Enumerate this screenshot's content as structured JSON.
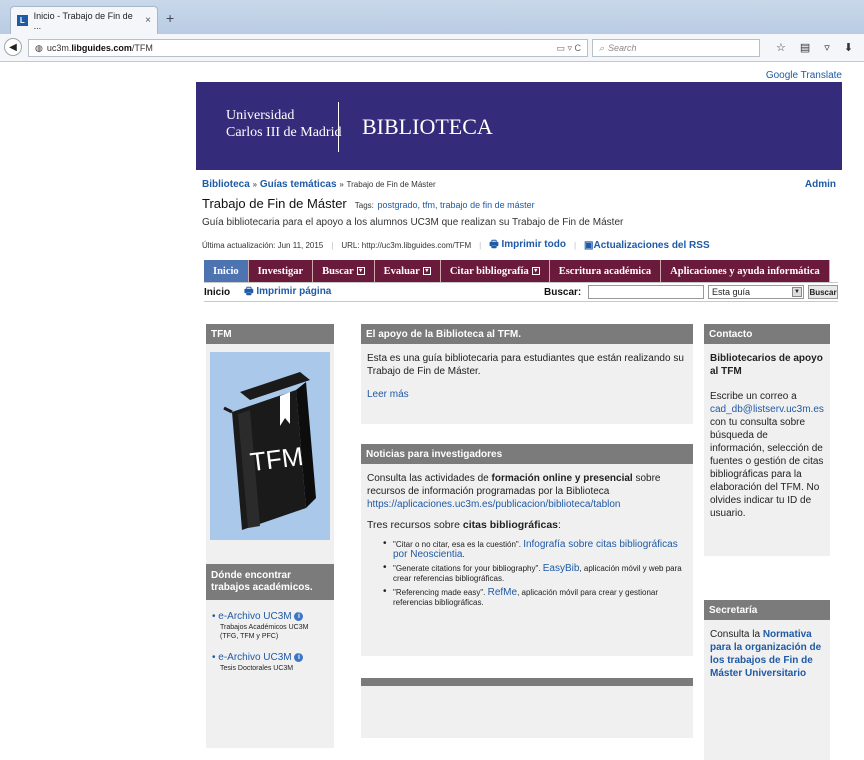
{
  "browser": {
    "tab_title": "Inicio - Trabajo de Fin de ...",
    "tab_close": "×",
    "new_tab": "+",
    "url_prefix": "uc3m.",
    "url_domain": "libguides.com",
    "url_path": "/TFM",
    "url_tools": "▭ ▿ C",
    "search_placeholder": "Search"
  },
  "top": {
    "google_translate": "Google Translate"
  },
  "banner": {
    "univ_line1": "Universidad",
    "univ_line2": "Carlos III de Madrid",
    "title": "BIBLIOTECA"
  },
  "breadcrumb": {
    "items": [
      "Biblioteca",
      "Guías temáticas",
      "Trabajo de Fin de Máster"
    ],
    "sep": "»",
    "admin": "Admin"
  },
  "guide": {
    "title": "Trabajo de Fin de Máster",
    "tags_label": "Tags:",
    "tags": "postgrado, tfm, trabajo de fin de máster",
    "description": "Guía bibliotecaria para el apoyo a los alumnos UC3M que realizan su Trabajo de Fin de Máster",
    "updated": "Última actualización: Jun 11, 2015",
    "url": "URL: http://uc3m.libguides.com/TFM",
    "print_all": "Imprimir todo",
    "rss": "Actualizaciones del RSS"
  },
  "menu": {
    "tabs": [
      {
        "label": "Inicio"
      },
      {
        "label": "Investigar"
      },
      {
        "label": "Buscar"
      },
      {
        "label": "Evaluar"
      },
      {
        "label": "Citar bibliografía"
      },
      {
        "label": "Escritura académica"
      },
      {
        "label": "Aplicaciones y ayuda informática"
      }
    ]
  },
  "subbar": {
    "home": "Inicio",
    "print_page": "Imprimir página",
    "search_label": "Buscar:",
    "scope": "Esta guía",
    "button": "Buscar"
  },
  "col1": {
    "header": "TFM",
    "book_text": "TFM",
    "header2": "Dónde encontrar trabajos académicos.",
    "items": [
      {
        "link": "e-Archivo UC3M",
        "text": "Trabajos Académicos UC3M (TFG, TFM y PFC)"
      },
      {
        "link": "e-Archivo UC3M",
        "text": "Tesis Doctorales UC3M"
      }
    ]
  },
  "col2": {
    "header1": "El apoyo de la Biblioteca al TFM.",
    "body1": "Esta es una guía bibliotecaria para estudiantes que están realizando su Trabajo de Fin de Máster.",
    "more": "Leer más",
    "header2": "Noticias para investigadores",
    "news_pre": "Consulta las actividades de ",
    "news_bold": "formación online y presencial",
    "news_post": " sobre recursos de información programadas por la Biblioteca",
    "news_link": "https://aplicaciones.uc3m.es/publicacion/biblioteca/tablon",
    "tres_pre": "Tres recursos sobre ",
    "tres_bold": "citas bibliográficas",
    "tres_post": ":",
    "resources": [
      {
        "a": "\"Citar o no citar, esa es la cuestión\". ",
        "link": "Infografía sobre citas bibliográficas por Neoscientia",
        "b": "."
      },
      {
        "a": "\"Generate citations for your bibliography\". ",
        "link": "EasyBib",
        "b": ", aplicación móvil y web para crear referencias bibliográficas."
      },
      {
        "a": "\"Referencing made easy\". ",
        "link": "RefMe",
        "b": ", aplicación móvil para crear y gestionar referencias bibliográficas."
      }
    ]
  },
  "col3": {
    "header1": "Contacto",
    "contact_title": "Bibliotecarios de apoyo al TFM",
    "contact_pre": "Escribe un correo a",
    "email": "cad_db@listserv.uc3m.es",
    "contact_post": "con tu consulta sobre búsqueda de información, selección de fuentes o gestión de citas bibliográficas para la elaboración del TFM. No olvides indicar tu ID de usuario.",
    "header2": "Secretaría",
    "sec_pre": "Consulta la",
    "sec_link": "Normativa para la organización de los trabajos de Fin de Máster Universitario"
  }
}
